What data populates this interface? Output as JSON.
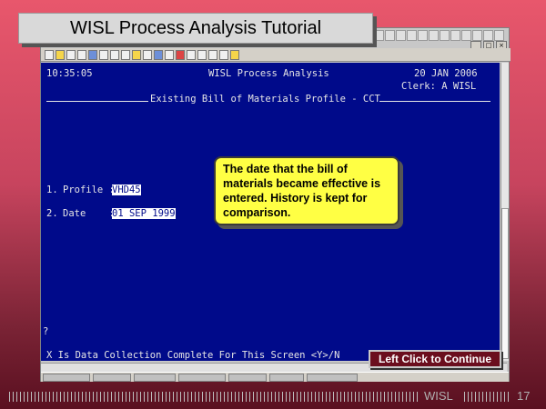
{
  "slide": {
    "title": "WISL Process Analysis Tutorial",
    "brand": "WISL",
    "page_number": "17"
  },
  "terminal": {
    "time": "10:35:05",
    "app_title": "WISL Process Analysis",
    "date": "20 JAN 2006",
    "clerk": "Clerk: A WISL",
    "screen_title": "Existing Bill of Materials Profile - CCT",
    "fields": [
      {
        "number": "1.",
        "label": "Profile :",
        "value": "VHD45"
      },
      {
        "number": "2.",
        "label": "Date    :",
        "value": "01 SEP 1999"
      }
    ],
    "prompt": "X Is Data Collection Complete For This Screen <Y>/N",
    "cursor": "?"
  },
  "callout": {
    "text": "The date that the bill of materials became effective is entered. History is kept for comparison."
  },
  "continue_button": {
    "label": "Left Click to Continue"
  },
  "colors": {
    "terminal_bg": "#000a8a",
    "callout_bg": "#ffff44",
    "button_bg": "#6b0e1e"
  }
}
